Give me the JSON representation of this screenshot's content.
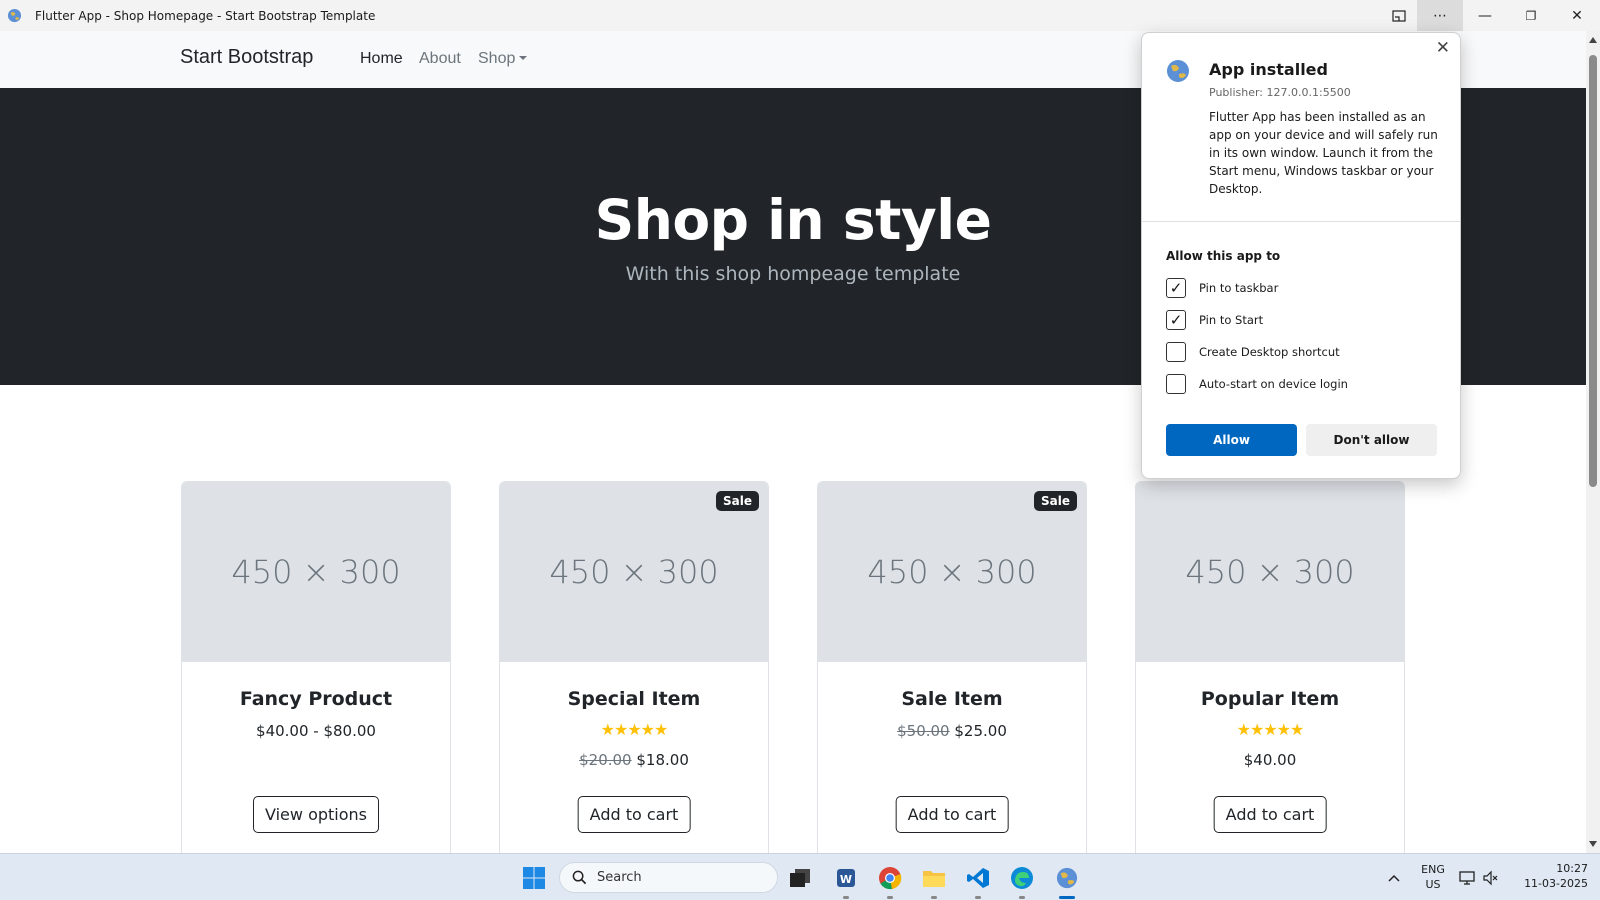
{
  "window": {
    "title": "Flutter App - Shop Homepage - Start Bootstrap Template",
    "more_label": "⋯",
    "minimize_label": "—",
    "maximize_label": "❐",
    "close_label": "✕"
  },
  "navbar": {
    "brand": "Start Bootstrap",
    "links": [
      {
        "label": "Home"
      },
      {
        "label": "About"
      },
      {
        "label": "Shop"
      }
    ]
  },
  "hero": {
    "title": "Shop in style",
    "subtitle": "With this shop hompeage template"
  },
  "products": [
    {
      "placeholder": "450 × 300",
      "name": "Fancy Product",
      "price": "$40.00 - $80.00",
      "button": "View options",
      "rating": 0
    },
    {
      "placeholder": "450 × 300",
      "badge": "Sale",
      "name": "Special Item",
      "old_price": "$20.00",
      "price": "$18.00",
      "button": "Add to cart",
      "rating": 5
    },
    {
      "placeholder": "450 × 300",
      "badge": "Sale",
      "name": "Sale Item",
      "old_price": "$50.00",
      "price": "$25.00",
      "button": "Add to cart",
      "rating": 0
    },
    {
      "placeholder": "450 × 300",
      "name": "Popular Item",
      "price": "$40.00",
      "button": "Add to cart",
      "rating": 5
    }
  ],
  "popup": {
    "close": "✕",
    "title": "App installed",
    "publisher": "Publisher: 127.0.0.1:5500",
    "description": "Flutter App has been installed as an app on your device and will safely run in its own window. Launch it from the Start menu, Windows taskbar or your Desktop.",
    "allow_heading": "Allow this app to",
    "options": [
      {
        "label": "Pin to taskbar",
        "checked": true
      },
      {
        "label": "Pin to Start",
        "checked": true
      },
      {
        "label": "Create Desktop shortcut",
        "checked": false
      },
      {
        "label": "Auto-start on device login",
        "checked": false
      }
    ],
    "allow_button": "Allow",
    "deny_button": "Don't allow"
  },
  "taskbar": {
    "search_placeholder": "Search",
    "language": "ENG",
    "region": "US",
    "time": "10:27",
    "date": "11-03-2025",
    "icons": [
      "windows-start-icon",
      "search-icon",
      "task-view-icon",
      "word-icon",
      "chrome-icon",
      "file-explorer-icon",
      "vscode-icon",
      "edge-icon",
      "flutter-app-icon"
    ]
  },
  "colors": {
    "hero_bg": "#212529",
    "star": "#ffc107",
    "allow_button": "#0067c0",
    "taskbar_bg": "#dfe8f3"
  }
}
